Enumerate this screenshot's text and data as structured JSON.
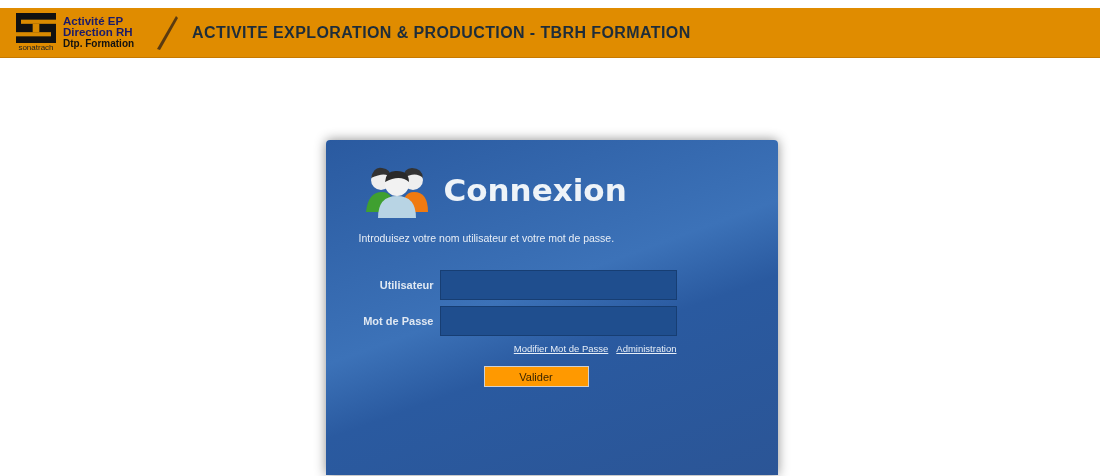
{
  "header": {
    "logo_caption": "sonatrach",
    "logo_lines": [
      "Activité EP",
      "Direction RH",
      "Dtp. Formation"
    ],
    "title": "ACTIVITE EXPLORATION & PRODUCTION - TBRH FORMATION"
  },
  "login": {
    "title": "Connexion",
    "intro": "Introduisez votre nom utilisateur et votre mot de passe.",
    "fields": [
      {
        "label": "Utilisateur"
      },
      {
        "label": "Mot de Passe"
      }
    ],
    "links": [
      "Modifier Mot de Passe",
      "Administration"
    ],
    "button": "Valider"
  }
}
